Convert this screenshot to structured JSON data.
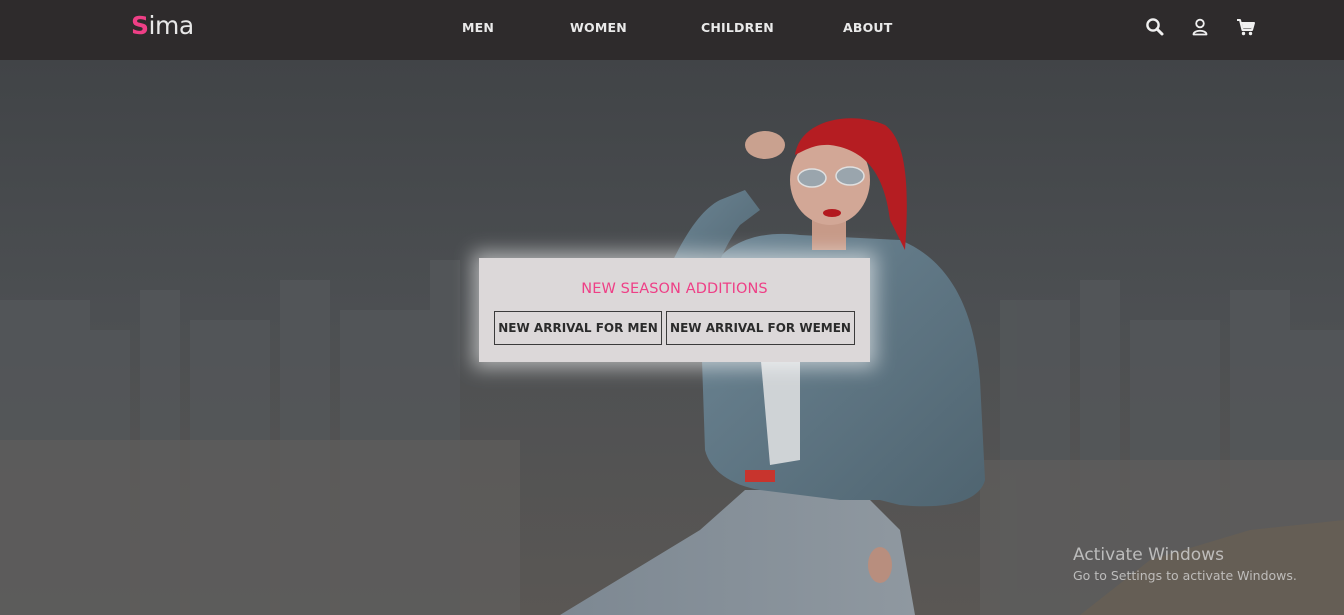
{
  "brand": {
    "logo_first": "S",
    "logo_rest": "ima",
    "accent_color": "#ee3f86"
  },
  "nav": {
    "links": [
      {
        "label": "MEN"
      },
      {
        "label": "WOMEN"
      },
      {
        "label": "CHILDREN"
      },
      {
        "label": "ABOUT"
      }
    ],
    "icons": [
      "search-icon",
      "user-icon",
      "cart-icon"
    ]
  },
  "promo": {
    "title": "NEW SEASON ADDITIONS",
    "buttons": [
      {
        "label": "NEW ARRIVAL FOR MEN"
      },
      {
        "label": "NEW ARRIVAL FOR WEMEN"
      }
    ]
  },
  "watermark": {
    "title": "Activate Windows",
    "subtitle": "Go to Settings to activate Windows."
  },
  "colors": {
    "navbar_bg": "#2e2b2c",
    "promo_bg": "#dcd8d9",
    "text_dark": "#2b2b2b"
  }
}
